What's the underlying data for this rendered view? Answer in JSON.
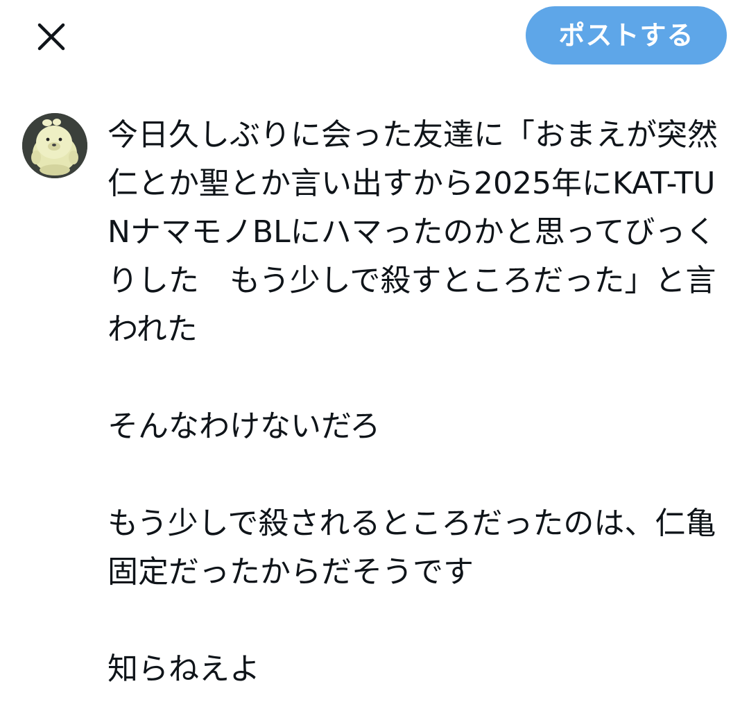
{
  "header": {
    "close_icon": "close-icon",
    "post_button_label": "ポストする",
    "post_button_color": "#5ea6e8"
  },
  "composer": {
    "avatar_icon": "avatar-seal-plush",
    "text": "今日久しぶりに会った友達に「おまえが突然仁とか聖とか言い出すから2025年にKAT-TUNナマモノBLにハマったのかと思ってびっくりした　もう少しで殺すところだった」と言われた\n\nそんなわけないだろ\n\nもう少しで殺されるところだったのは、仁亀固定だったからだそうです\n\n知らねえよ"
  }
}
